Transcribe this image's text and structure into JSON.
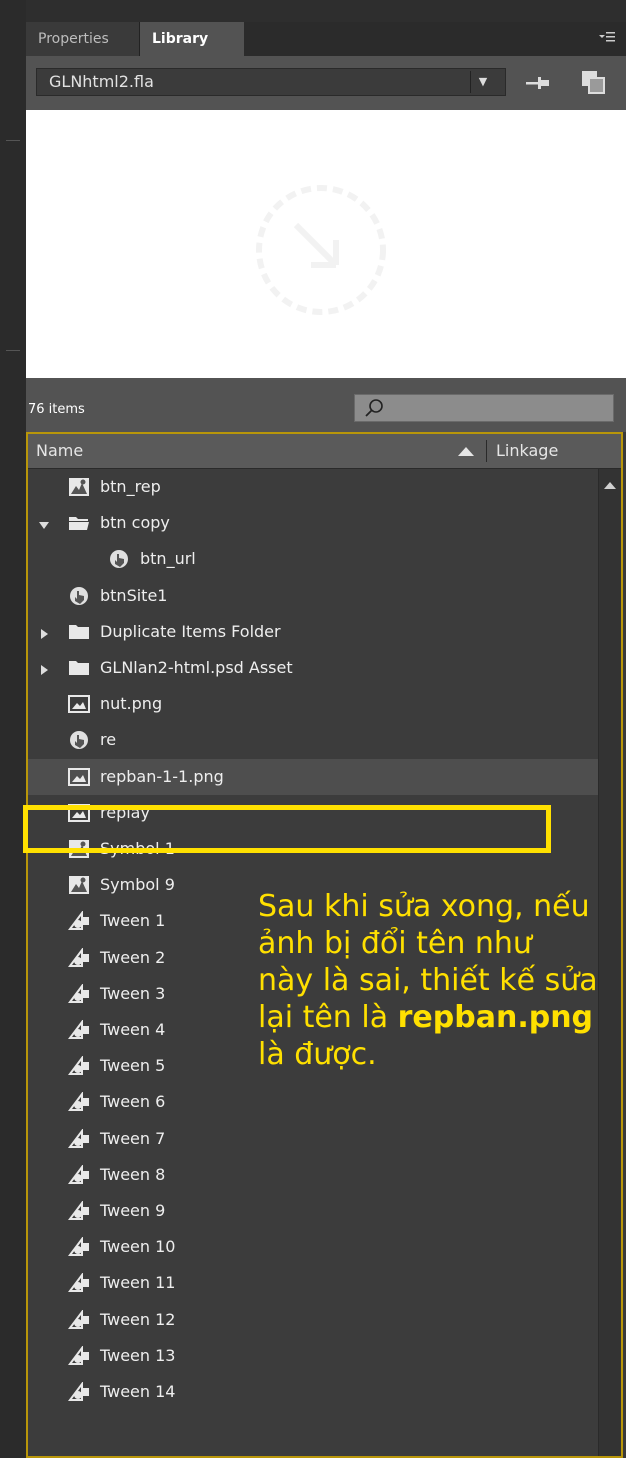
{
  "tabs": [
    {
      "label": "Properties"
    },
    {
      "label": "Library"
    }
  ],
  "library": {
    "file": "GLNhtml2.fla",
    "item_count": "76 items"
  },
  "columns": {
    "name": "Name",
    "linkage": "Linkage"
  },
  "items": [
    {
      "label": "btn_rep",
      "icon": "movieclip-icon",
      "indent": 0,
      "arrow": ""
    },
    {
      "label": "btn copy",
      "icon": "open-folder-icon",
      "indent": 0,
      "arrow": "expanded"
    },
    {
      "label": "btn_url",
      "icon": "button-symbol-icon",
      "indent": 1,
      "arrow": ""
    },
    {
      "label": "btnSite1",
      "icon": "button-symbol-icon",
      "indent": 0,
      "arrow": ""
    },
    {
      "label": "Duplicate Items Folder",
      "icon": "folder-icon",
      "indent": 0,
      "arrow": "collapsed"
    },
    {
      "label": "GLNlan2-html.psd Asset",
      "icon": "folder-icon",
      "indent": 0,
      "arrow": "collapsed"
    },
    {
      "label": "nut.png",
      "icon": "bitmap-icon",
      "indent": 0,
      "arrow": ""
    },
    {
      "label": "re",
      "icon": "button-symbol-icon",
      "indent": 0,
      "arrow": ""
    },
    {
      "label": "repban-1-1.png",
      "icon": "bitmap-icon",
      "indent": 0,
      "arrow": ""
    },
    {
      "label": "replay",
      "icon": "bitmap-icon",
      "indent": 0,
      "arrow": ""
    },
    {
      "label": "Symbol 1",
      "icon": "movieclip-icon",
      "indent": 0,
      "arrow": ""
    },
    {
      "label": "Symbol 9",
      "icon": "movieclip-icon",
      "indent": 0,
      "arrow": ""
    },
    {
      "label": "Tween 1",
      "icon": "graphic-symbol-icon",
      "indent": 0,
      "arrow": ""
    },
    {
      "label": "Tween 2",
      "icon": "graphic-symbol-icon",
      "indent": 0,
      "arrow": ""
    },
    {
      "label": "Tween 3",
      "icon": "graphic-symbol-icon",
      "indent": 0,
      "arrow": ""
    },
    {
      "label": "Tween 4",
      "icon": "graphic-symbol-icon",
      "indent": 0,
      "arrow": ""
    },
    {
      "label": "Tween 5",
      "icon": "graphic-symbol-icon",
      "indent": 0,
      "arrow": ""
    },
    {
      "label": "Tween 6",
      "icon": "graphic-symbol-icon",
      "indent": 0,
      "arrow": ""
    },
    {
      "label": "Tween 7",
      "icon": "graphic-symbol-icon",
      "indent": 0,
      "arrow": ""
    },
    {
      "label": "Tween 8",
      "icon": "graphic-symbol-icon",
      "indent": 0,
      "arrow": ""
    },
    {
      "label": "Tween 9",
      "icon": "graphic-symbol-icon",
      "indent": 0,
      "arrow": ""
    },
    {
      "label": "Tween 10",
      "icon": "graphic-symbol-icon",
      "indent": 0,
      "arrow": ""
    },
    {
      "label": "Tween 11",
      "icon": "graphic-symbol-icon",
      "indent": 0,
      "arrow": ""
    },
    {
      "label": "Tween 12",
      "icon": "graphic-symbol-icon",
      "indent": 0,
      "arrow": ""
    },
    {
      "label": "Tween 13",
      "icon": "graphic-symbol-icon",
      "indent": 0,
      "arrow": ""
    },
    {
      "label": "Tween 14",
      "icon": "graphic-symbol-icon",
      "indent": 0,
      "arrow": ""
    }
  ],
  "selected_item": "repban-1-1.png",
  "annotation": {
    "line1": "Sau khi sửa xong, nếu",
    "line2": "ảnh bị đổi tên như",
    "line3": "này là sai, thiết kế sửa",
    "line4_prefix": "lại tên là ",
    "line4_bold": "repban.png",
    "line5": "là được."
  },
  "colors": {
    "panel_bg": "#535353",
    "list_bg": "#3c3c3c",
    "highlight": "#ffe000",
    "frame": "#b8960a"
  }
}
